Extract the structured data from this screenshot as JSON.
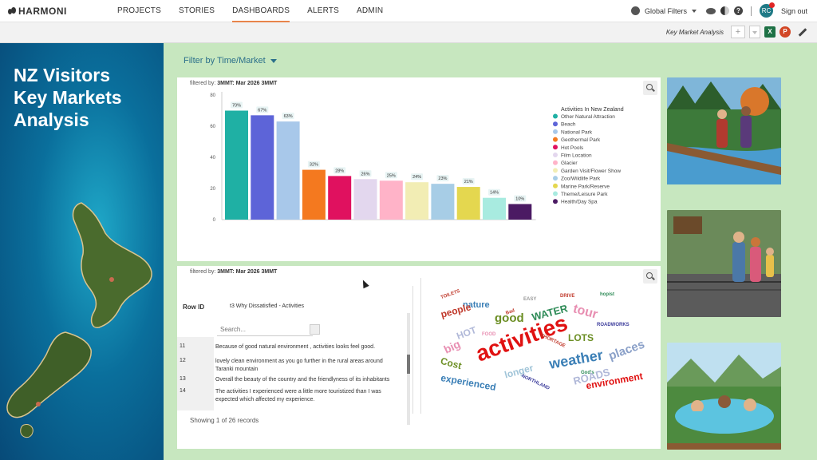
{
  "app": {
    "logo": "HARMONI"
  },
  "nav": [
    {
      "label": "PROJECTS",
      "active": false
    },
    {
      "label": "STORIES",
      "active": false
    },
    {
      "label": "DASHBOARDS",
      "active": true
    },
    {
      "label": "ALERTS",
      "active": false
    },
    {
      "label": "ADMIN",
      "active": false
    }
  ],
  "topright": {
    "global_filters": "Global Filters",
    "help": "?",
    "avatar": "RC",
    "signout": "Sign out"
  },
  "subbar": {
    "dashboard_name": "Key Market Analysis",
    "add": "+",
    "excel": "X",
    "ppt": "P"
  },
  "hero": {
    "line1": "NZ Visitors",
    "line2": "Key Markets",
    "line3": "Analysis"
  },
  "filter_link": "Filter by Time/Market",
  "panel_top": {
    "filtered_prefix": "filtered by: ",
    "filtered_value": "3MMT: Mar 2026 3MMT"
  },
  "panel_bottom": {
    "filtered_prefix": "filtered by: ",
    "filtered_value": "3MMT: Mar 2026 3MMT"
  },
  "chart_data": {
    "type": "bar",
    "categories": [
      "Other Natural Attraction",
      "Beach",
      "National Park",
      "Geothermal Park",
      "Hot Pools",
      "Film Location",
      "Glacier",
      "Garden Visit/Flower Show",
      "Zoo/Wildlife Park",
      "Marine Park/Reserve",
      "Theme/Leisure Park",
      "Health/Day Spa"
    ],
    "values": [
      70,
      67,
      63,
      32,
      28,
      26,
      25,
      24,
      23,
      21,
      14,
      10
    ],
    "value_labels": [
      "70%",
      "67%",
      "63%",
      "32%",
      "28%",
      "26%",
      "25%",
      "24%",
      "23%",
      "21%",
      "14%",
      "10%"
    ],
    "colors": [
      "#1fb0a4",
      "#5d64d8",
      "#a8c8ea",
      "#f4791f",
      "#e0115f",
      "#e3d7ee",
      "#ffb3c8",
      "#f2edb4",
      "#a7cde6",
      "#e4d74f",
      "#a8ebe0",
      "#4b1a63"
    ],
    "yticks": [
      0,
      20,
      40,
      60,
      80
    ],
    "ylim": [
      0,
      80
    ],
    "legend_title": "Activities In New Zealand",
    "legend_position": "right",
    "grid": false
  },
  "table": {
    "col_rowid": "Row ID",
    "col_why": "t3 Why Dissatisfied - Activities",
    "search_placeholder": "Search...",
    "rows": [
      {
        "id": "11",
        "text": "Because of good natural environment , activities looks feel good."
      },
      {
        "id": "12",
        "text": "lovely clean environment as you go further in the rural areas around Taranki mountain"
      },
      {
        "id": "13",
        "text": "Overall the beauty of the country and the friendlyness of its inhabitants"
      },
      {
        "id": "14",
        "text": "The activities I experienced were a little more touristized than I was expected which affected my experience."
      }
    ],
    "showing": "Showing 1 of 26 records"
  },
  "wordcloud": [
    {
      "w": "TOILETS",
      "c": "#c0392b"
    },
    {
      "w": "nature",
      "c": "#3b7fb6"
    },
    {
      "w": "EASY",
      "c": "#999999"
    },
    {
      "w": "DRIVE",
      "c": "#c0392b"
    },
    {
      "w": "hopist",
      "c": "#2e8b57"
    },
    {
      "w": "people",
      "c": "#c0392b"
    },
    {
      "w": "Bad",
      "c": "#c0392b"
    },
    {
      "w": "good",
      "c": "#6b8e23"
    },
    {
      "w": "WATER",
      "c": "#2e8b57"
    },
    {
      "w": "tour",
      "c": "#e88fb2"
    },
    {
      "w": "HOT",
      "c": "#b0b8d8"
    },
    {
      "w": "FOOD",
      "c": "#e88fb2"
    },
    {
      "w": "activities",
      "c": "#e01212"
    },
    {
      "w": "ROADWORKS",
      "c": "#3b3b9b"
    },
    {
      "w": "LOTS",
      "c": "#6b8e23"
    },
    {
      "w": "big",
      "c": "#e88fb2"
    },
    {
      "w": "SHORTAGE",
      "c": "#c0392b"
    },
    {
      "w": "places",
      "c": "#8aa0c8"
    },
    {
      "w": "weather",
      "c": "#3b7fb6"
    },
    {
      "w": "Cost",
      "c": "#6b8e23"
    },
    {
      "w": "longer",
      "c": "#a0c4d8"
    },
    {
      "w": "God's",
      "c": "#2e8b57"
    },
    {
      "w": "ROADS",
      "c": "#b0b8d8"
    },
    {
      "w": "NORTHLAND",
      "c": "#3b3b9b"
    },
    {
      "w": "environment",
      "c": "#e01212"
    },
    {
      "w": "experienced",
      "c": "#3b7fb6"
    }
  ]
}
